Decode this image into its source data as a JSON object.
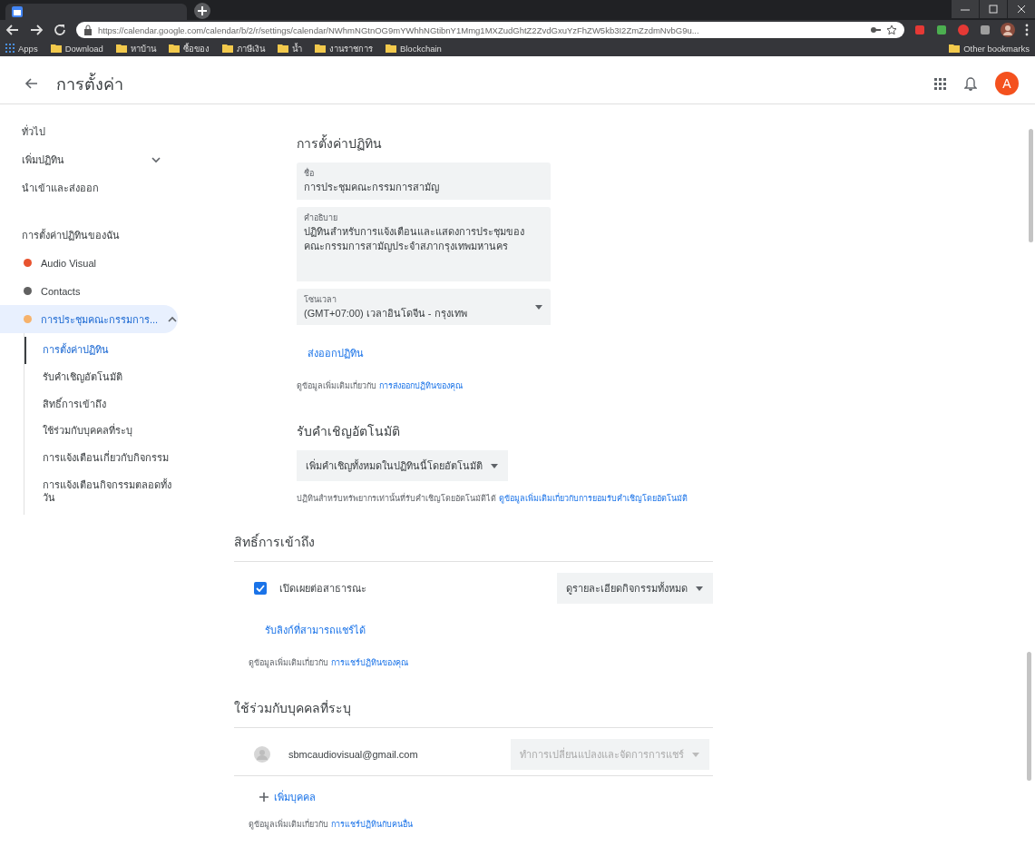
{
  "browser": {
    "url": "https://calendar.google.com/calendar/b/2/r/settings/calendar/NWhmNGtnOG9mYWhhNGtibnY1Mmg1MXZudGhtZ2ZvdGxuYzFhZW5kb3I2ZmZzdmNvbG9u...",
    "bookmarks": [
      {
        "label": "Apps",
        "kind": "apps"
      },
      {
        "label": "Download",
        "kind": "folder"
      },
      {
        "label": "หาบ้าน",
        "kind": "folder"
      },
      {
        "label": "ซื้อของ",
        "kind": "folder"
      },
      {
        "label": "ภาษีเงิน",
        "kind": "folder"
      },
      {
        "label": "น้ำ",
        "kind": "folder"
      },
      {
        "label": "งานราชการ",
        "kind": "folder"
      },
      {
        "label": "Blockchain",
        "kind": "folder"
      }
    ],
    "other_bookmarks": "Other bookmarks"
  },
  "header": {
    "title": "การตั้งค่า",
    "avatar_letter": "A"
  },
  "sidebar": {
    "items": [
      {
        "label": "ทั่วไป",
        "kind": "link"
      },
      {
        "label": "เพิ่มปฏิทิน",
        "kind": "expandable",
        "expanded": false
      },
      {
        "label": "นำเข้าและส่งออก",
        "kind": "link"
      }
    ],
    "calendars_heading": "การตั้งค่าปฏิทินของฉัน",
    "calendars": [
      {
        "label": "Audio Visual",
        "color": "#e8532f",
        "selected": false
      },
      {
        "label": "Contacts",
        "color": "#616161",
        "selected": false
      },
      {
        "label": "การประชุมคณะกรรมการ...",
        "color": "#f6b26b",
        "selected": true,
        "expanded": true,
        "children": [
          {
            "label": "การตั้งค่าปฏิทิน",
            "selected": true
          },
          {
            "label": "รับคำเชิญอัตโนมัติ",
            "selected": false
          },
          {
            "label": "สิทธิ์การเข้าถึง",
            "selected": false
          },
          {
            "label": "ใช้ร่วมกับบุคคลที่ระบุ",
            "selected": false
          },
          {
            "label": "การแจ้งเตือนเกี่ยวกับกิจกรรม",
            "selected": false
          },
          {
            "label": "การแจ้งเตือนกิจกรรมตลอดทั้งวัน",
            "selected": false
          }
        ]
      }
    ]
  },
  "sections": [
    {
      "kind": "calendar_settings",
      "title": "การตั้งค่าปฏิทิน",
      "name_field": {
        "label": "ชื่อ",
        "value": "การประชุมคณะกรรมการสามัญ"
      },
      "description_field": {
        "label": "คำอธิบาย",
        "value": "ปฏิทินสำหรับการแจ้งเตือนและแสดงการประชุมของคณะกรรมการสามัญประจำสภากรุงเทพมหานคร"
      },
      "timezone_field": {
        "label": "โซนเวลา",
        "value": "(GMT+07:00) เวลาอินโดจีน - กรุงเทพ"
      },
      "button": "ส่งออกปฏิทิน",
      "help": {
        "text": "ดูข้อมูลเพิ่มเติมเกี่ยวกับ",
        "link": "การส่งออกปฏิทินของคุณ"
      }
    },
    {
      "kind": "auto_accept",
      "title": "รับคำเชิญอัตโนมัติ",
      "dropdown": "เพิ่มคำเชิญทั้งหมดในปฏิทินนี้โดยอัตโนมัติ",
      "help": {
        "text": "ปฏิทินสำหรับทรัพยากรเท่านั้นที่รับคำเชิญโดยอัตโนมัติได้",
        "link": "ดูข้อมูลเพิ่มเติมเกี่ยวกับการยอมรับคำเชิญโดยอัตโนมัติ"
      }
    },
    {
      "kind": "access",
      "title": "สิทธิ์การเข้าถึง",
      "checkbox": {
        "label": "เปิดเผยต่อสาธารณะ",
        "checked": true
      },
      "dropdown": "ดูรายละเอียดกิจกรรมทั้งหมด",
      "button": "รับลิงก์ที่สามารถแชร์ได้",
      "help": {
        "text": "ดูข้อมูลเพิ่มเติมเกี่ยวกับ",
        "link": "การแชร์ปฏิทินของคุณ"
      }
    },
    {
      "kind": "share",
      "title": "ใช้ร่วมกับบุคคลที่ระบุ",
      "people": [
        {
          "email": "sbmcaudiovisual@gmail.com",
          "permission": "ทำการเปลี่ยนแปลงและจัดการการแชร์",
          "disabled": true
        }
      ],
      "button": "เพิ่มบุคคล",
      "help": {
        "text": "ดูข้อมูลเพิ่มเติมเกี่ยวกับ",
        "link": "การแชร์ปฏิทินกับคนอื่น"
      }
    }
  ]
}
